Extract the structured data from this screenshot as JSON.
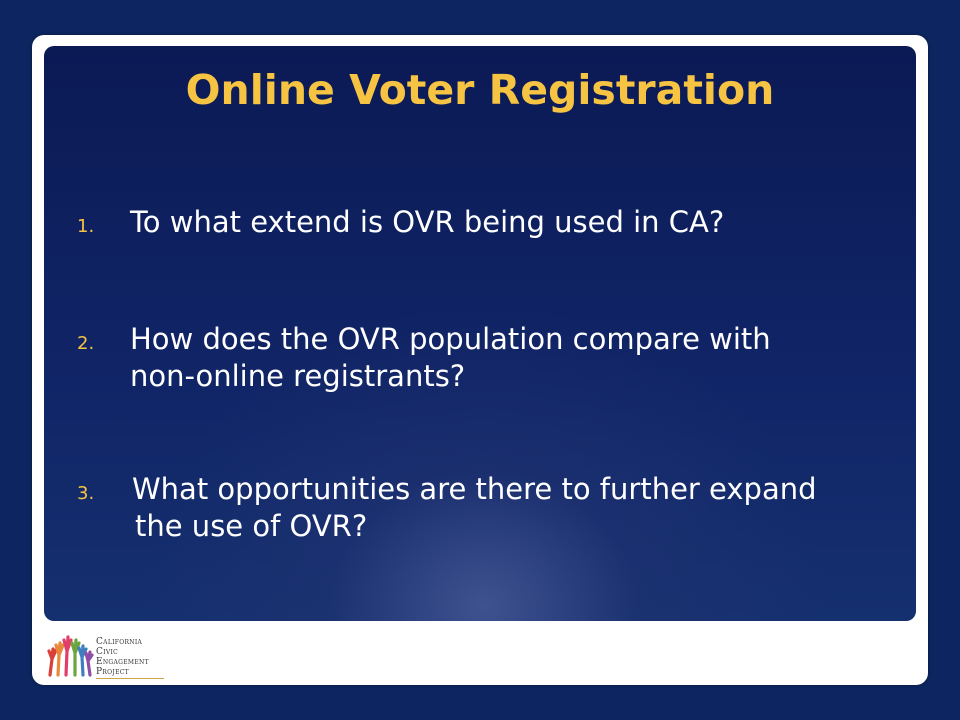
{
  "slide": {
    "title": "Online Voter Registration",
    "questions": [
      {
        "number": "1.",
        "line1": "To what extend is OVR being used in CA?",
        "line2": ""
      },
      {
        "number": "2.",
        "line1": "How does the OVR population compare with",
        "line2": "non-online registrants?"
      },
      {
        "number": "3.",
        "line1": "What opportunities are there to further expand",
        "line2": "the use of OVR?"
      }
    ]
  },
  "logo": {
    "line1": "California",
    "line2": "Civic",
    "line3": "Engagement",
    "line4": "Project"
  },
  "colors": {
    "background": "#0d2560",
    "title": "#f6c442",
    "text": "#ffffff",
    "numbers": "#f6c442"
  }
}
